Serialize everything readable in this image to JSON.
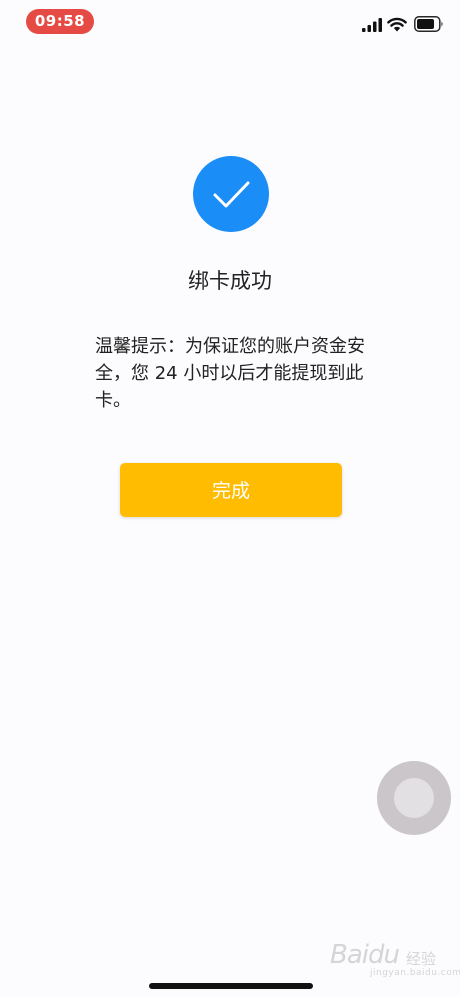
{
  "status_bar": {
    "time": "09:58",
    "time_pill_color": "#e64a44",
    "icons": [
      "signal-icon",
      "wifi-icon",
      "battery-icon"
    ]
  },
  "result": {
    "icon": "checkmark-icon",
    "icon_color": "#1a8df7",
    "title": "绑卡成功",
    "notice": "温馨提示：为保证您的账户资金安全，您 24 小时以后才能提现到此卡。"
  },
  "actions": {
    "done_label": "完成",
    "done_color": "#ffbc00"
  },
  "overlay": {
    "assistive_touch": "assistive-touch-button"
  },
  "watermark": {
    "logo": "Baidu",
    "sub": "经验",
    "url": "jingyan.baidu.com"
  }
}
